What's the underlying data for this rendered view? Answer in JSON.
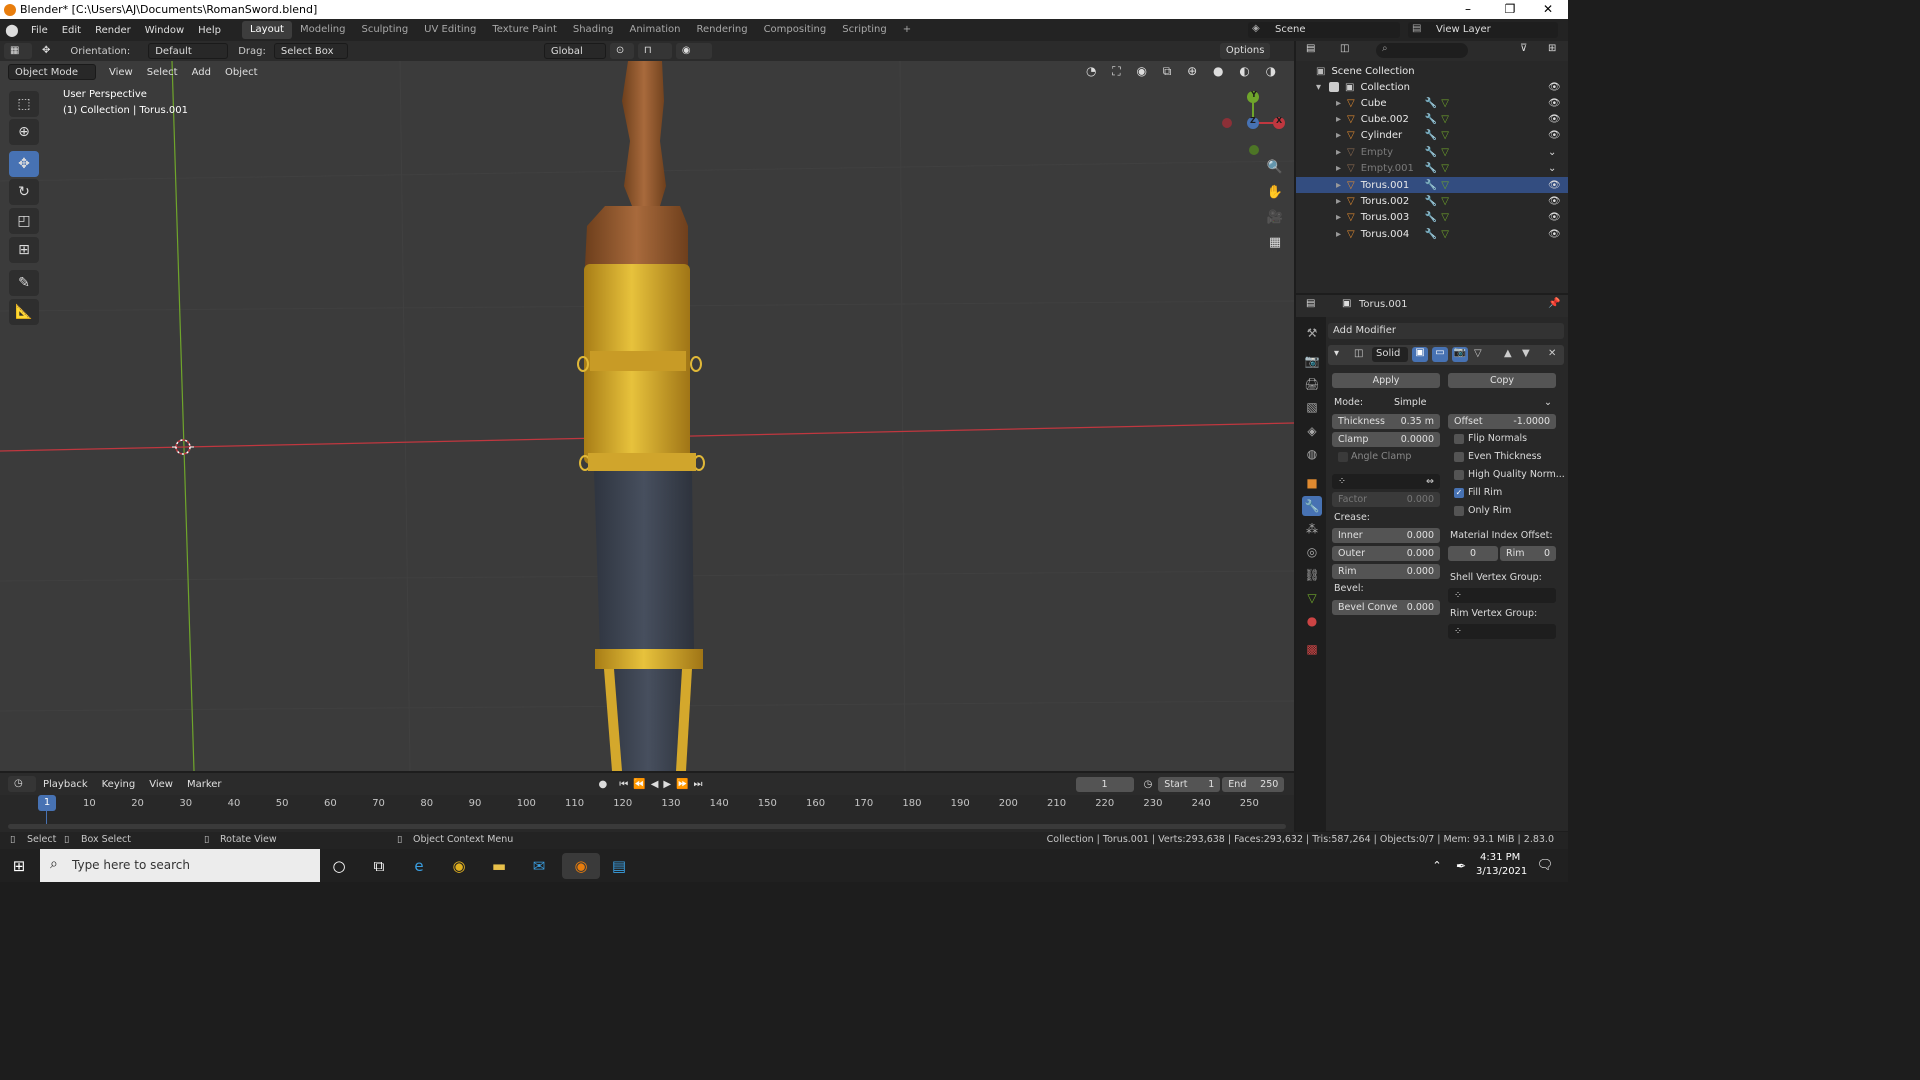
{
  "window": {
    "title": "Blender* [C:\\Users\\AJ\\Documents\\RomanSword.blend]",
    "min": "–",
    "max": "❐",
    "close": "✕"
  },
  "menu": [
    "File",
    "Edit",
    "Render",
    "Window",
    "Help"
  ],
  "workspaces": [
    "Layout",
    "Modeling",
    "Sculpting",
    "UV Editing",
    "Texture Paint",
    "Shading",
    "Animation",
    "Rendering",
    "Compositing",
    "Scripting"
  ],
  "workspace_add": "+",
  "scene": {
    "label": "Scene",
    "view_layer": "View Layer"
  },
  "tool_header": {
    "orientation_label": "Orientation:",
    "orientation_value": "Default",
    "drag_label": "Drag:",
    "drag_value": "Select Box",
    "transform_orientation": "Global",
    "options": "Options"
  },
  "viewport_header": {
    "mode": "Object Mode",
    "menus": [
      "View",
      "Select",
      "Add",
      "Object"
    ]
  },
  "viewport_overlay": {
    "perspective": "User Perspective",
    "collection": "(1) Collection | Torus.001"
  },
  "gizmo": {
    "y": "Y",
    "x": "X",
    "z": "Z"
  },
  "outliner": {
    "scene_collection": "Scene Collection",
    "collection": "Collection",
    "items": [
      {
        "name": "Cube",
        "dim": false,
        "sel": false
      },
      {
        "name": "Cube.002",
        "dim": false,
        "sel": false
      },
      {
        "name": "Cylinder",
        "dim": false,
        "sel": false
      },
      {
        "name": "Empty",
        "dim": true,
        "sel": false
      },
      {
        "name": "Empty.001",
        "dim": true,
        "sel": false
      },
      {
        "name": "Torus.001",
        "dim": false,
        "sel": true
      },
      {
        "name": "Torus.002",
        "dim": false,
        "sel": false
      },
      {
        "name": "Torus.003",
        "dim": false,
        "sel": false
      },
      {
        "name": "Torus.004",
        "dim": false,
        "sel": false
      }
    ]
  },
  "properties": {
    "object_name": "Torus.001",
    "add_modifier": "Add Modifier",
    "modifier_name": "Solid",
    "apply": "Apply",
    "copy": "Copy",
    "mode_label": "Mode:",
    "mode_value": "Simple",
    "thickness_label": "Thickness",
    "thickness_value": "0.35 m",
    "offset_label": "Offset",
    "offset_value": "-1.0000",
    "clamp_label": "Clamp",
    "clamp_value": "0.0000",
    "angle_clamp": "Angle Clamp",
    "flip_normals": "Flip Normals",
    "even_thickness": "Even Thickness",
    "high_quality": "High Quality Norm...",
    "fill_rim": "Fill Rim",
    "only_rim": "Only Rim",
    "factor_label": "Factor",
    "factor_value": "0.000",
    "crease_label": "Crease:",
    "inner_label": "Inner",
    "inner_value": "0.000",
    "outer_label": "Outer",
    "outer_value": "0.000",
    "rim_label": "Rim",
    "rim_value": "0.000",
    "material_index_label": "Material Index Offset:",
    "mat_offset_value": "0",
    "mat_rim_label": "Rim",
    "mat_rim_value": "0",
    "shell_vg": "Shell Vertex Group:",
    "rim_vg": "Rim Vertex Group:",
    "bevel_label": "Bevel:",
    "bevel_convex_label": "Bevel Conve",
    "bevel_convex_value": "0.000"
  },
  "timeline": {
    "menus": [
      "Playback",
      "Keying",
      "View",
      "Marker"
    ],
    "current_frame": "1",
    "start_label": "Start",
    "start_value": "1",
    "end_label": "End",
    "end_value": "250",
    "ticks": [
      "10",
      "20",
      "30",
      "40",
      "50",
      "60",
      "70",
      "80",
      "90",
      "100",
      "110",
      "120",
      "130",
      "140",
      "150",
      "160",
      "170",
      "180",
      "190",
      "200",
      "210",
      "220",
      "230",
      "240",
      "250"
    ]
  },
  "statusbar": {
    "select": "Select",
    "box_select": "Box Select",
    "rotate": "Rotate View",
    "context_menu": "Object Context Menu",
    "stats": "Collection | Torus.001 | Verts:293,638 | Faces:293,632 | Tris:587,264 | Objects:0/7 | Mem: 93.1 MiB | 2.83.0"
  },
  "taskbar": {
    "search_placeholder": "Type here to search",
    "time": "4:31 PM",
    "date": "3/13/2021"
  },
  "colors": {
    "accent": "#4772b3",
    "gold": "#d4a82c",
    "blade": "#3e4553",
    "wood": "#9a6238",
    "x_axis": "#c0373f",
    "y_axis": "#6fa52b"
  }
}
